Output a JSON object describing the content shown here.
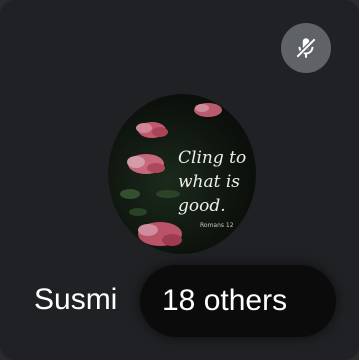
{
  "participant": {
    "name": "Susmi",
    "avatar_quote_lines": [
      "Cling to",
      "what is",
      "good."
    ],
    "avatar_reference": "Romans 12"
  },
  "controls": {
    "mic_state_icon": "mic-off-icon"
  },
  "overflow_chip": {
    "label": "18 others"
  },
  "colors": {
    "tile_background": "#202124",
    "mute_button": "#5f6368",
    "chip_background": "#0b0b0c",
    "flower_pink": "#e0667f"
  }
}
